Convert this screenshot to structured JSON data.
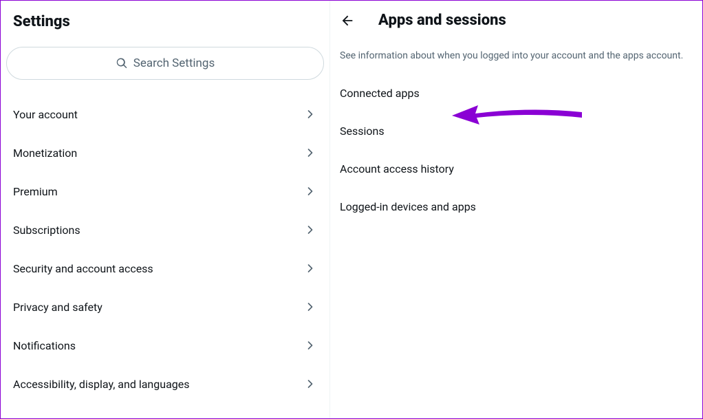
{
  "left": {
    "title": "Settings",
    "search_placeholder": "Search Settings",
    "items": [
      {
        "label": "Your account"
      },
      {
        "label": "Monetization"
      },
      {
        "label": "Premium"
      },
      {
        "label": "Subscriptions"
      },
      {
        "label": "Security and account access"
      },
      {
        "label": "Privacy and safety"
      },
      {
        "label": "Notifications"
      },
      {
        "label": "Accessibility, display, and languages"
      }
    ]
  },
  "right": {
    "title": "Apps and sessions",
    "description": "See information about when you logged into your account and the apps account.",
    "items": [
      {
        "label": "Connected apps"
      },
      {
        "label": "Sessions"
      },
      {
        "label": "Account access history"
      },
      {
        "label": "Logged-in devices and apps"
      }
    ]
  }
}
